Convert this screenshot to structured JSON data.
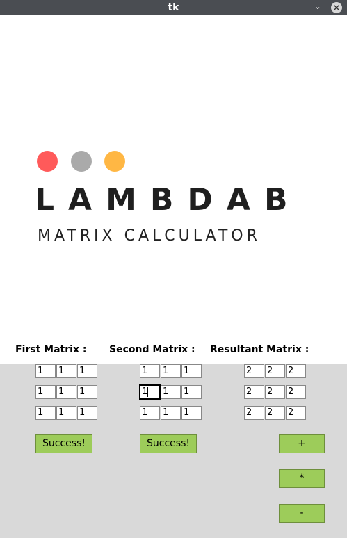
{
  "window": {
    "title": "tk"
  },
  "banner": {
    "brand": "LAMBDAB",
    "subtitle": "MATRIX CALCULATOR"
  },
  "labels": {
    "first": "First Matrix :",
    "second": "Second Matrix :",
    "result": "Resultant Matrix :"
  },
  "first_matrix": [
    [
      "1",
      "1",
      "1"
    ],
    [
      "1",
      "1",
      "1"
    ],
    [
      "1",
      "1",
      "1"
    ]
  ],
  "second_matrix": [
    [
      "1",
      "1",
      "1"
    ],
    [
      "1",
      "1",
      "1"
    ],
    [
      "1",
      "1",
      "1"
    ]
  ],
  "result_matrix": [
    [
      "2",
      "2",
      "2"
    ],
    [
      "2",
      "2",
      "2"
    ],
    [
      "2",
      "2",
      "2"
    ]
  ],
  "buttons": {
    "first_success": "Success!",
    "second_success": "Success!",
    "add": "+",
    "multiply": "*",
    "subtract": "-"
  },
  "colors": {
    "button": "#9dcc5a",
    "dot_red": "#ff5a5a",
    "dot_grey": "#aaaaaa",
    "dot_yellow": "#ffb744"
  }
}
